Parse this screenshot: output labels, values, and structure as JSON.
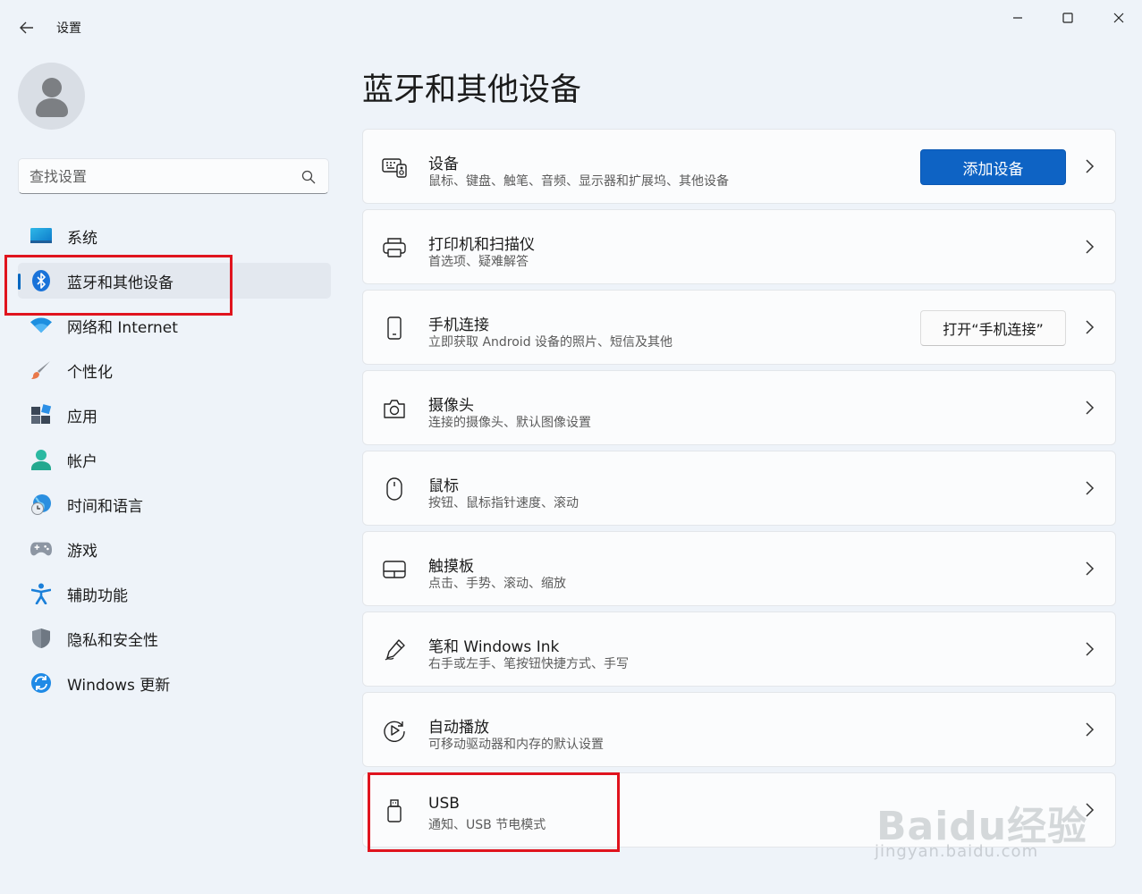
{
  "window": {
    "app_title": "设置",
    "back_icon": "back-arrow-icon",
    "controls": [
      "minimize-icon",
      "maximize-icon",
      "close-icon"
    ]
  },
  "sidebar": {
    "search_placeholder": "查找设置",
    "nav_items": [
      {
        "label": "系统",
        "icon": "system-icon",
        "active": false
      },
      {
        "label": "蓝牙和其他设备",
        "icon": "bluetooth-icon",
        "active": true
      },
      {
        "label": "网络和 Internet",
        "icon": "wifi-icon",
        "active": false
      },
      {
        "label": "个性化",
        "icon": "paintbrush-icon",
        "active": false
      },
      {
        "label": "应用",
        "icon": "apps-icon",
        "active": false
      },
      {
        "label": "帐户",
        "icon": "account-icon",
        "active": false
      },
      {
        "label": "时间和语言",
        "icon": "time-language-icon",
        "active": false
      },
      {
        "label": "游戏",
        "icon": "gamepad-icon",
        "active": false
      },
      {
        "label": "辅助功能",
        "icon": "accessibility-icon",
        "active": false
      },
      {
        "label": "隐私和安全性",
        "icon": "shield-icon",
        "active": false
      },
      {
        "label": "Windows 更新",
        "icon": "windows-update-icon",
        "active": false
      }
    ]
  },
  "main": {
    "title": "蓝牙和其他设备",
    "cards": [
      {
        "title": "设备",
        "subtitle": "鼠标、键盘、触笔、音频、显示器和扩展坞、其他设备",
        "icon": "devices-icon",
        "button": "添加设备"
      },
      {
        "title": "打印机和扫描仪",
        "subtitle": "首选项、疑难解答",
        "icon": "printer-icon"
      },
      {
        "title": "手机连接",
        "subtitle": "立即获取 Android 设备的照片、短信及其他",
        "icon": "phone-icon",
        "button": "打开“手机连接”"
      },
      {
        "title": "摄像头",
        "subtitle": "连接的摄像头、默认图像设置",
        "icon": "camera-icon"
      },
      {
        "title": "鼠标",
        "subtitle": "按钮、鼠标指针速度、滚动",
        "icon": "mouse-icon"
      },
      {
        "title": "触摸板",
        "subtitle": "点击、手势、滚动、缩放",
        "icon": "touchpad-icon"
      },
      {
        "title": "笔和 Windows Ink",
        "subtitle": "右手或左手、笔按钮快捷方式、手写",
        "icon": "pen-icon"
      },
      {
        "title": "自动播放",
        "subtitle": "可移动驱动器和内存的默认设置",
        "icon": "autoplay-icon"
      },
      {
        "title": "USB",
        "subtitle": "通知、USB 节电模式",
        "icon": "usb-icon"
      }
    ]
  },
  "watermark": {
    "brand": "Baidu经验",
    "url": "jingyan.baidu.com"
  },
  "colors": {
    "accent": "#0067c0",
    "primary_button": "#0e63c4",
    "highlight_box": "#e0141e",
    "background": "#eef3f9"
  }
}
